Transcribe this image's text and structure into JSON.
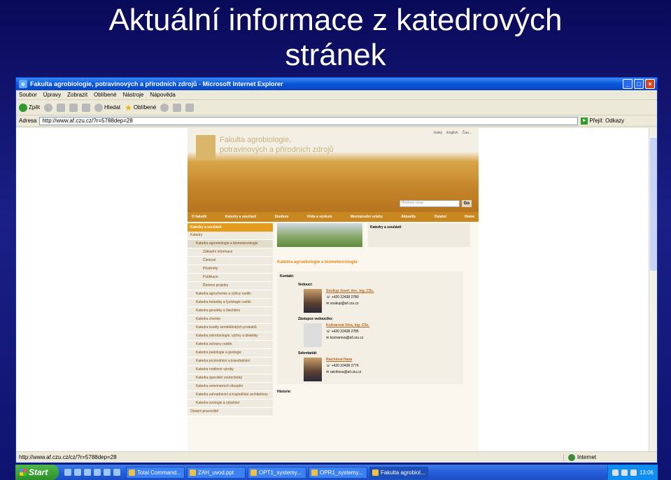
{
  "slide": {
    "title_line1": "Aktuální informace z katedrových",
    "title_line2": "stránek"
  },
  "browser": {
    "window_title": "Fakulta agrobiologie, potravinových a přírodních zdrojů - Microsoft Internet Explorer",
    "menu": [
      "Soubor",
      "Úpravy",
      "Zobrazit",
      "Oblíbené",
      "Nástroje",
      "Nápověda"
    ],
    "toolbar": {
      "back": "Zpět",
      "search": "Hledat",
      "favorites": "Oblíbené"
    },
    "address_label": "Adresa",
    "address_url": "http://www.af.czu.cz/?r=5788dep=28",
    "go_label": "Přejít",
    "links_label": "Odkazy",
    "status_url": "http://www.af.czu.cz/cz/?r=5788dep=28",
    "status_zone": "Internet"
  },
  "site": {
    "logo_line1": "Fakulta agrobiologie,",
    "logo_line2": "potravinových a přírodních zdrojů",
    "lang_links": [
      "česky",
      "English",
      "Čau..."
    ],
    "search_placeholder": "Hledaný výraz",
    "search_go": "Go",
    "nav": [
      "O fakultě",
      "Katedry a součásti",
      "Studium",
      "Věda a výzkum",
      "Mezinárodní vztahy",
      "Aktuality",
      "Ostatní",
      "Home"
    ],
    "leftnav_head": "Katedry a součásti",
    "leftnav_items": [
      {
        "label": "Katedry",
        "lvl": 1
      },
      {
        "label": "Katedra agroekologie a biometeorologie",
        "lvl": 2,
        "active": true
      },
      {
        "label": "Základní informace",
        "lvl": 3
      },
      {
        "label": "Členové",
        "lvl": 3
      },
      {
        "label": "Předměty",
        "lvl": 3
      },
      {
        "label": "Publikace",
        "lvl": 3
      },
      {
        "label": "Řešené projekty",
        "lvl": 3
      },
      {
        "label": "Katedra agrochemie a výživy rostlin",
        "lvl": 2
      },
      {
        "label": "Katedra botaniky a fyziologie rostlin",
        "lvl": 2
      },
      {
        "label": "Katedra genetiky a šlechtění",
        "lvl": 2
      },
      {
        "label": "Katedra chemie",
        "lvl": 2
      },
      {
        "label": "Katedra kvality zemědělských produktů",
        "lvl": 2
      },
      {
        "label": "Katedra mikrobiologie, výživy a dietetiky",
        "lvl": 2
      },
      {
        "label": "Katedra ochrany rostlin",
        "lvl": 2
      },
      {
        "label": "Katedra pedologie a geologie",
        "lvl": 2
      },
      {
        "label": "Katedra pícninářství a trávníkářství",
        "lvl": 2
      },
      {
        "label": "Katedra rostlinné výroby",
        "lvl": 2
      },
      {
        "label": "Katedra speciální zootechniky",
        "lvl": 2
      },
      {
        "label": "Katedra veterinárních disciplín",
        "lvl": 2
      },
      {
        "label": "Katedra zahradnictví a krajinářské architektury",
        "lvl": 2
      },
      {
        "label": "Katedra zoologie a rybářství",
        "lvl": 2
      },
      {
        "label": "Ostatní pracoviště",
        "lvl": 1
      }
    ],
    "kat_box_title": "Katedry a součásti",
    "dept_title": "Katedra agroekologie a biometeorologie",
    "contact_label": "Kontakt:",
    "people": [
      {
        "role": "Vedoucí:",
        "name": "Soukup Josef, doc. Ing. CSc.",
        "phone": "+420 22438 2780",
        "email": "soukup@af.czu.cz",
        "photo": true
      },
      {
        "role": "Zástupce vedoucího:",
        "name": "Kožnarová Věra, Ing. CSc.",
        "phone": "+420 22438 2785",
        "email": "koznarova@af.czu.cz",
        "photo": false
      },
      {
        "role": "Sekretariát:",
        "name": "Raichlová Hana",
        "phone": "+420 22438 2776",
        "email": "raichlova@af.czu.cz",
        "photo": true
      }
    ],
    "history_label": "Historie:"
  },
  "taskbar": {
    "start": "Start",
    "tasks": [
      "Total Command...",
      "ZAH_uvod.ppt",
      "OPT1_systemy...",
      "OPR1_systemy...",
      "Fakulta agrobiol..."
    ],
    "active_task": 4,
    "clock": "13:06"
  }
}
